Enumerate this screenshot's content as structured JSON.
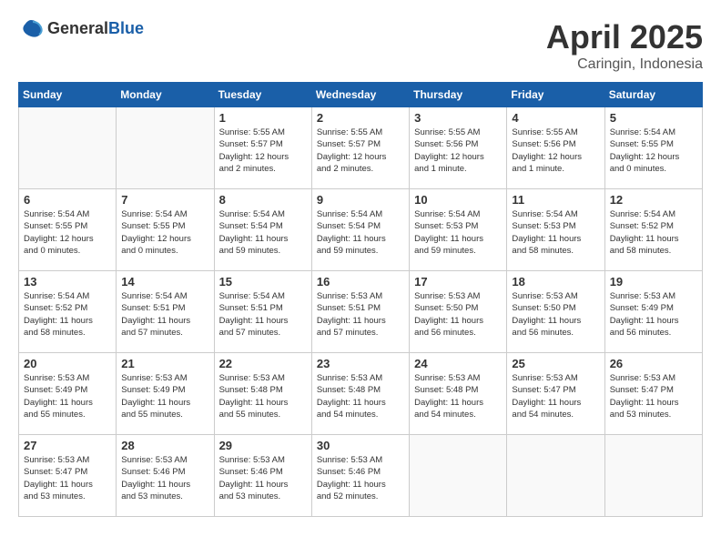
{
  "header": {
    "logo_general": "General",
    "logo_blue": "Blue",
    "month_year": "April 2025",
    "location": "Caringin, Indonesia"
  },
  "days_of_week": [
    "Sunday",
    "Monday",
    "Tuesday",
    "Wednesday",
    "Thursday",
    "Friday",
    "Saturday"
  ],
  "weeks": [
    [
      {
        "day": "",
        "info": ""
      },
      {
        "day": "",
        "info": ""
      },
      {
        "day": "1",
        "info": "Sunrise: 5:55 AM\nSunset: 5:57 PM\nDaylight: 12 hours\nand 2 minutes."
      },
      {
        "day": "2",
        "info": "Sunrise: 5:55 AM\nSunset: 5:57 PM\nDaylight: 12 hours\nand 2 minutes."
      },
      {
        "day": "3",
        "info": "Sunrise: 5:55 AM\nSunset: 5:56 PM\nDaylight: 12 hours\nand 1 minute."
      },
      {
        "day": "4",
        "info": "Sunrise: 5:55 AM\nSunset: 5:56 PM\nDaylight: 12 hours\nand 1 minute."
      },
      {
        "day": "5",
        "info": "Sunrise: 5:54 AM\nSunset: 5:55 PM\nDaylight: 12 hours\nand 0 minutes."
      }
    ],
    [
      {
        "day": "6",
        "info": "Sunrise: 5:54 AM\nSunset: 5:55 PM\nDaylight: 12 hours\nand 0 minutes."
      },
      {
        "day": "7",
        "info": "Sunrise: 5:54 AM\nSunset: 5:55 PM\nDaylight: 12 hours\nand 0 minutes."
      },
      {
        "day": "8",
        "info": "Sunrise: 5:54 AM\nSunset: 5:54 PM\nDaylight: 11 hours\nand 59 minutes."
      },
      {
        "day": "9",
        "info": "Sunrise: 5:54 AM\nSunset: 5:54 PM\nDaylight: 11 hours\nand 59 minutes."
      },
      {
        "day": "10",
        "info": "Sunrise: 5:54 AM\nSunset: 5:53 PM\nDaylight: 11 hours\nand 59 minutes."
      },
      {
        "day": "11",
        "info": "Sunrise: 5:54 AM\nSunset: 5:53 PM\nDaylight: 11 hours\nand 58 minutes."
      },
      {
        "day": "12",
        "info": "Sunrise: 5:54 AM\nSunset: 5:52 PM\nDaylight: 11 hours\nand 58 minutes."
      }
    ],
    [
      {
        "day": "13",
        "info": "Sunrise: 5:54 AM\nSunset: 5:52 PM\nDaylight: 11 hours\nand 58 minutes."
      },
      {
        "day": "14",
        "info": "Sunrise: 5:54 AM\nSunset: 5:51 PM\nDaylight: 11 hours\nand 57 minutes."
      },
      {
        "day": "15",
        "info": "Sunrise: 5:54 AM\nSunset: 5:51 PM\nDaylight: 11 hours\nand 57 minutes."
      },
      {
        "day": "16",
        "info": "Sunrise: 5:53 AM\nSunset: 5:51 PM\nDaylight: 11 hours\nand 57 minutes."
      },
      {
        "day": "17",
        "info": "Sunrise: 5:53 AM\nSunset: 5:50 PM\nDaylight: 11 hours\nand 56 minutes."
      },
      {
        "day": "18",
        "info": "Sunrise: 5:53 AM\nSunset: 5:50 PM\nDaylight: 11 hours\nand 56 minutes."
      },
      {
        "day": "19",
        "info": "Sunrise: 5:53 AM\nSunset: 5:49 PM\nDaylight: 11 hours\nand 56 minutes."
      }
    ],
    [
      {
        "day": "20",
        "info": "Sunrise: 5:53 AM\nSunset: 5:49 PM\nDaylight: 11 hours\nand 55 minutes."
      },
      {
        "day": "21",
        "info": "Sunrise: 5:53 AM\nSunset: 5:49 PM\nDaylight: 11 hours\nand 55 minutes."
      },
      {
        "day": "22",
        "info": "Sunrise: 5:53 AM\nSunset: 5:48 PM\nDaylight: 11 hours\nand 55 minutes."
      },
      {
        "day": "23",
        "info": "Sunrise: 5:53 AM\nSunset: 5:48 PM\nDaylight: 11 hours\nand 54 minutes."
      },
      {
        "day": "24",
        "info": "Sunrise: 5:53 AM\nSunset: 5:48 PM\nDaylight: 11 hours\nand 54 minutes."
      },
      {
        "day": "25",
        "info": "Sunrise: 5:53 AM\nSunset: 5:47 PM\nDaylight: 11 hours\nand 54 minutes."
      },
      {
        "day": "26",
        "info": "Sunrise: 5:53 AM\nSunset: 5:47 PM\nDaylight: 11 hours\nand 53 minutes."
      }
    ],
    [
      {
        "day": "27",
        "info": "Sunrise: 5:53 AM\nSunset: 5:47 PM\nDaylight: 11 hours\nand 53 minutes."
      },
      {
        "day": "28",
        "info": "Sunrise: 5:53 AM\nSunset: 5:46 PM\nDaylight: 11 hours\nand 53 minutes."
      },
      {
        "day": "29",
        "info": "Sunrise: 5:53 AM\nSunset: 5:46 PM\nDaylight: 11 hours\nand 53 minutes."
      },
      {
        "day": "30",
        "info": "Sunrise: 5:53 AM\nSunset: 5:46 PM\nDaylight: 11 hours\nand 52 minutes."
      },
      {
        "day": "",
        "info": ""
      },
      {
        "day": "",
        "info": ""
      },
      {
        "day": "",
        "info": ""
      }
    ]
  ]
}
